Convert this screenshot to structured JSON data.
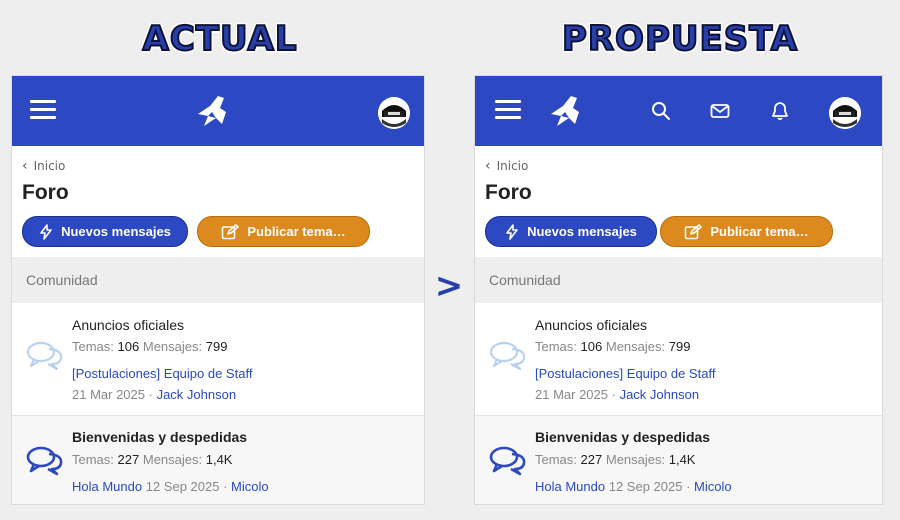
{
  "headings": {
    "left": "ACTUAL",
    "right": "PROPUESTA"
  },
  "arrow": ">",
  "colors": {
    "primary": "#2c48c2",
    "orange": "#dc8a1e",
    "section_bg": "#eeeeee"
  },
  "icons": {
    "menu": "hamburger-menu-icon",
    "logo": "site-logo",
    "search": "search-icon",
    "mail": "mail-icon",
    "bell": "bell-icon",
    "bolt": "bolt-icon",
    "edit": "edit-icon",
    "forum_light": "chat-bubbles-icon",
    "forum_dark": "chat-bubbles-icon"
  },
  "panel": {
    "breadcrumb": "Inicio",
    "title": "Foro",
    "btn_new": "Nuevos mensajes",
    "btn_post": "Publicar tema…",
    "section": "Comunidad",
    "forums": [
      {
        "title": "Anuncios oficiales",
        "temas_label": "Temas:",
        "temas": "106",
        "mensajes_label": "Mensajes:",
        "mensajes": "799",
        "latest_title": "[Postulaciones] Equipo de Staff",
        "latest_date": "21 Mar 2025 ·",
        "latest_user": "Jack Johnson"
      },
      {
        "title": "Bienvenidas y despedidas",
        "temas_label": "Temas:",
        "temas": "227",
        "mensajes_label": "Mensajes:",
        "mensajes": "1,4K",
        "latest_title": "Hola Mundo",
        "latest_date": "12 Sep 2025 ·",
        "latest_user": "Micolo"
      }
    ]
  }
}
